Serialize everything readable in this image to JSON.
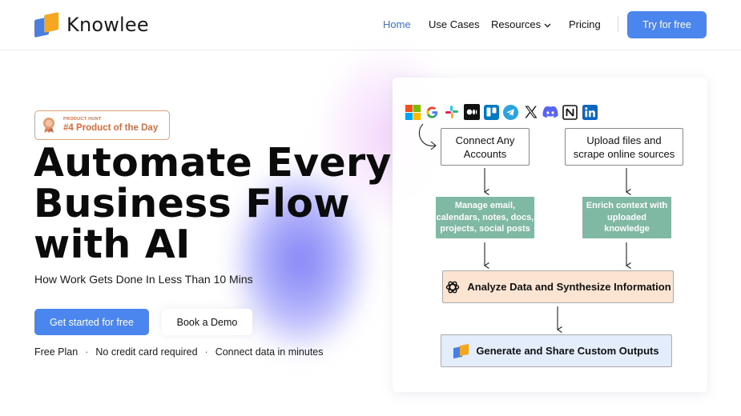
{
  "brand": {
    "name": "Knowlee",
    "blue": "#4a7fe0",
    "orange": "#f5a623"
  },
  "nav": {
    "home": "Home",
    "use_cases": "Use Cases",
    "resources": "Resources",
    "pricing": "Pricing",
    "try_button": "Try for free",
    "accent": "#4a86ee"
  },
  "hero": {
    "badge_small": "PRODUCT HUNT",
    "badge_big": "#4 Product of the Day",
    "headline": [
      "Automate Every",
      "Business Flow",
      "with AI"
    ],
    "subhead": "How Work Gets Done In Less Than 10 Mins",
    "cta_primary": "Get started for free",
    "cta_secondary": "Book a Demo",
    "features": [
      "Free Plan",
      "No credit card required",
      "Connect data in minutes"
    ],
    "separator": "·"
  },
  "diagram": {
    "icons": [
      "microsoft-icon",
      "google-icon",
      "slack-icon",
      "medium-icon",
      "trello-icon",
      "telegram-icon",
      "x-icon",
      "discord-icon",
      "notion-icon",
      "linkedin-icon"
    ],
    "connect": [
      "Connect Any",
      "Accounts"
    ],
    "upload": [
      "Upload files and",
      "scrape online sources"
    ],
    "manage": [
      "Manage email,",
      "calendars, notes, docs,",
      "projects, social posts"
    ],
    "enrich": [
      "Enrich context with",
      "uploaded",
      "knowledge"
    ],
    "analyze": "Analyze Data and Synthesize Information",
    "generate": "Generate and Share Custom Outputs",
    "colors": {
      "green": "#7fb9a3",
      "orange_box": "#fbe5d2",
      "blue_box": "#e3edfb"
    }
  }
}
